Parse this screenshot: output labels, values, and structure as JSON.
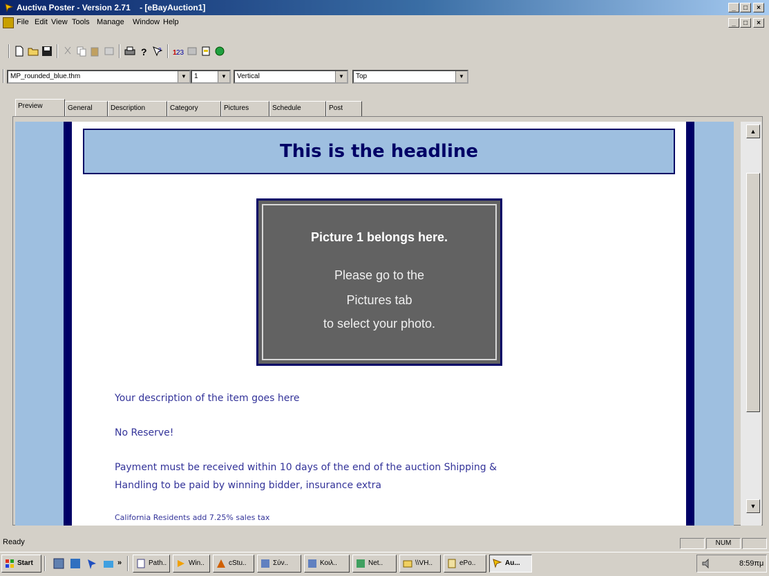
{
  "window": {
    "title": "Auctiva Poster - Version 2.71    - [eBayAuction1]"
  },
  "menu": [
    "File",
    "Edit",
    "View",
    "Tools",
    "Manage",
    "Window",
    "Help"
  ],
  "combos": {
    "template": "MP_rounded_blue.thm",
    "count": "1",
    "layout": "Vertical",
    "position": "Top"
  },
  "tabs": [
    "Preview",
    "General",
    "Description",
    "Category",
    "Pictures",
    "Schedule",
    "Post"
  ],
  "preview": {
    "headline": "This is the headline",
    "picture_title": "Picture 1 belongs here.",
    "picture_lines": [
      "Please go to the",
      "Pictures tab",
      "to select your photo."
    ],
    "description": "Your description of the item goes here",
    "reserve": "No Reserve!",
    "payment_line1": "Payment must be received within 10 days of the end of the auction Shipping &",
    "payment_line2": "Handling to be paid by winning bidder, insurance extra",
    "tax": "California Residents add 7.25% sales tax"
  },
  "status": {
    "text": "Ready",
    "num": "NUM"
  },
  "taskbar": {
    "start": "Start",
    "chevron": "»",
    "buttons": [
      "Path..",
      "Win..",
      "cStu..",
      "Σύν..",
      "Κοιλ..",
      "Net..",
      "\\\\VH..",
      "ePo..",
      "Au..."
    ],
    "clock": "8:59πμ"
  }
}
